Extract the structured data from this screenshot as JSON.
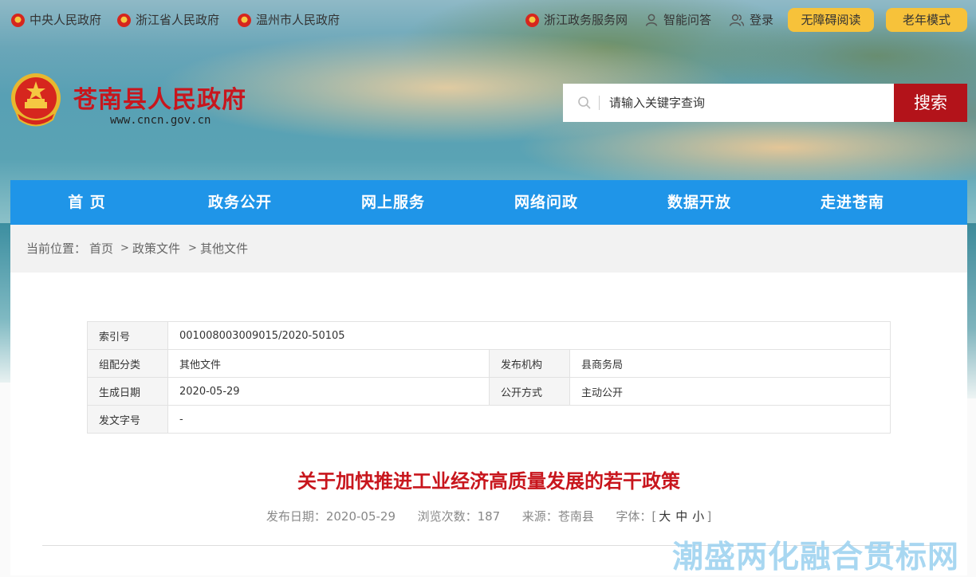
{
  "top_links": {
    "central_gov": "中央人民政府",
    "zhejiang_gov": "浙江省人民政府",
    "wenzhou_gov": "温州市人民政府",
    "zj_service": "浙江政务服务网",
    "smart_qa": "智能问答",
    "login": "登录",
    "accessible": "无障碍阅读",
    "elderly": "老年模式"
  },
  "site": {
    "title": "苍南县人民政府",
    "url": "www.cncn.gov.cn"
  },
  "search": {
    "placeholder": "请输入关键字查询",
    "button": "搜索"
  },
  "nav": [
    "首 页",
    "政务公开",
    "网上服务",
    "网络问政",
    "数据开放",
    "走进苍南"
  ],
  "breadcrumb": {
    "prefix": "当前位置：",
    "items": [
      "首页",
      "政策文件",
      "其他文件"
    ],
    "separator": ">"
  },
  "meta_table": {
    "index_no_label": "索引号",
    "index_no": "001008003009015/2020-50105",
    "category_label": "组配分类",
    "category": "其他文件",
    "publisher_label": "发布机构",
    "publisher": "县商务局",
    "date_label": "生成日期",
    "date": "2020-05-29",
    "open_mode_label": "公开方式",
    "open_mode": "主动公开",
    "doc_no_label": "发文字号",
    "doc_no": "-"
  },
  "article": {
    "title": "关于加快推进工业经济高质量发展的若干政策",
    "publish_label": "发布日期：",
    "publish_date": "2020-05-29",
    "views_label": "浏览次数：",
    "views": "187",
    "source_label": "来源：",
    "source": "苍南县",
    "font_label": "字体：",
    "font_open": "[",
    "font_large": "大",
    "font_medium": "中",
    "font_small": "小",
    "font_close": "]"
  },
  "watermark": "潮盛两化融合贯标网",
  "colors": {
    "brand_red": "#c8161d",
    "nav_blue": "#1f95e8",
    "pill_yellow": "#f7c23a",
    "search_red": "#b3131a"
  }
}
